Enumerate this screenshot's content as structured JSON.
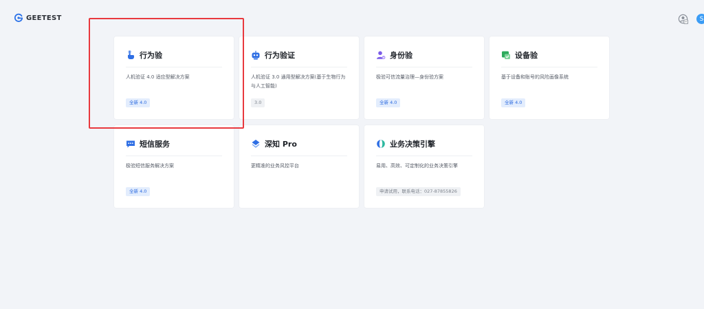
{
  "header": {
    "logo_text": "GEETEST",
    "avatar_letter": "S"
  },
  "cards": [
    {
      "title": "行为验",
      "description": "人机验证 4.0 适应型解决方案",
      "tag": "全新 4.0",
      "icon": "hand-tap-icon"
    },
    {
      "title": "行为验证",
      "description": "人机验证 3.0 通用型解决方案(基于生物行为与人工智能)",
      "tag": "3.0",
      "icon": "robot-icon"
    },
    {
      "title": "身份验",
      "description": "极验可信流量治理—身份验方案",
      "tag": "全新 4.0",
      "icon": "user-check-icon"
    },
    {
      "title": "设备验",
      "description": "基于设备和账号的风险画像系统",
      "tag": "全新 4.0",
      "icon": "device-check-icon"
    },
    {
      "title": "短信服务",
      "description": "极验短信服务解决方案",
      "tag": "全新 4.0",
      "icon": "message-icon"
    },
    {
      "title": "深知 Pro",
      "description": "更精准的业务风控平台",
      "tag": "",
      "icon": "layers-icon"
    },
    {
      "title": "业务决策引擎",
      "description": "易用、高效、可定制化的业务决策引擎",
      "tag": "申请试用，联系电话：027-87855826",
      "icon": "decision-engine-icon"
    }
  ],
  "colors": {
    "background": "#f2f4f8",
    "brand_blue": "#2c6be0",
    "highlight_red": "#e8383d"
  }
}
